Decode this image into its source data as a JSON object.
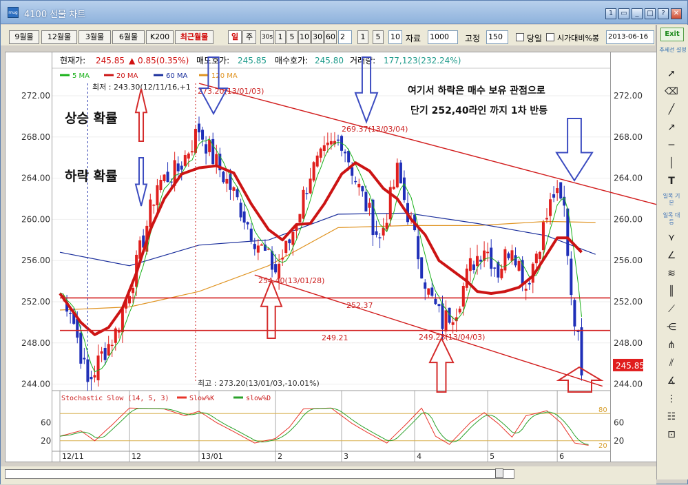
{
  "window": {
    "title": "4100 선물 차트",
    "controls": [
      "help-btn",
      "restore",
      "minimize",
      "maximize",
      "?",
      "X"
    ]
  },
  "toolbar": {
    "period_buttons": [
      "9월물",
      "12월물",
      "3월물",
      "6월물",
      "K200",
      "최근월물"
    ],
    "unit_buttons": [
      "일",
      "주"
    ],
    "interval_value": "30s",
    "minute_buttons": [
      "1",
      "5",
      "10",
      "30",
      "60"
    ],
    "interval_input": "2",
    "small_buttons": [
      "1",
      "5"
    ],
    "input_10": "10",
    "data_label": "자료",
    "data_count": "1000",
    "fixed_label": "고정",
    "fixed_value": "150",
    "today_label": "당일",
    "time_compare_label": "시가대비%봉",
    "date_value": "2013-06-16"
  },
  "sidebar": {
    "exit_label": "Exit",
    "setting_label": "추세선 설정",
    "tools": [
      "cursor-tool",
      "eraser-tool",
      "line-tool",
      "arrow-line-tool",
      "horizontal-line-tool",
      "vertical-line-tool",
      "text-tool"
    ],
    "text_tools": [
      "일목 기본",
      "일목 대등"
    ],
    "extra_tools": [
      "fan-tool",
      "fibonacci-tool",
      "speed-lines-tool",
      "cycle-tool",
      "gann-tool",
      "gann-fan-tool",
      "pitchfork-tool",
      "channel-tool",
      "angle-tool",
      "regression-tool",
      "retracement-tool"
    ]
  },
  "header": {
    "current_label": "현재가:",
    "current_value": "245.85",
    "change_value": "▲ 0.85(0.35%)",
    "ask_label": "매도호가:",
    "ask_value": "245.85",
    "bid_label": "매수호가:",
    "bid_value": "245.80",
    "volume_label": "거래량:",
    "volume_value": "177,123(232.24%)"
  },
  "annotations": {
    "up_prob": "상승 확률",
    "down_prob": "하락 확률",
    "note_line1": "여기서 하락은 매수 보유 관점으로",
    "note_line2": "단기 252,40라인 까지 1차 반등",
    "low_label": "최저 : 243.30(12/11/16,+1",
    "high_label": "최고 : 273.20(13/01/03,-10.01%)",
    "label_273": "273.20(13/01/03)",
    "label_269": "269.37(13/03/04)",
    "label_254": "254.40(13/01/28)",
    "label_249_28": "249.28(13/04/03)",
    "label_252_37": "252.37",
    "label_249_21": "249.21",
    "current_price_tag": "245.85"
  },
  "colors": {
    "up_candle": "#e0201e",
    "down_candle": "#1f2fb8",
    "ma5": "#19b119",
    "ma20": "#cc1414",
    "ma60": "#1b2f9c",
    "ma120": "#e09422",
    "trend": "#d21e1e",
    "stoch_k": "#e8342a",
    "stoch_d": "#2aa12a"
  },
  "chart_data": [
    {
      "type": "candlestick",
      "title": "4100 선물 차트",
      "legend": [
        "5 MA",
        "20 MA",
        "60 MA",
        "120 MA"
      ],
      "ylim": [
        242.5,
        274
      ],
      "y_ticks": [
        "244.00",
        "248.00",
        "252.00",
        "256.00",
        "260.00",
        "264.00",
        "268.00",
        "272.00"
      ],
      "x_tick_labels": [
        "12/11",
        "12",
        "13/01",
        "2",
        "3",
        "4",
        "5",
        "6"
      ],
      "x_tick_index": [
        0,
        20,
        40,
        62,
        81,
        102,
        123,
        143
      ],
      "n_days": 154,
      "key_points": [
        {
          "label": "low",
          "idx": 8,
          "value": 243.3
        },
        {
          "label": "high",
          "idx": 40,
          "value": 273.2
        },
        {
          "label": "swing_low",
          "idx": 62,
          "value": 254.4
        },
        {
          "label": "swing_high",
          "idx": 81,
          "value": 269.37
        },
        {
          "label": "swing_low2",
          "idx": 108,
          "value": 249.28
        },
        {
          "label": "recent_high",
          "idx": 142,
          "value": 264.0
        },
        {
          "label": "current",
          "idx": 150,
          "value": 245.85
        }
      ],
      "horizontal_lines": [
        252.37,
        249.21
      ],
      "trendline_upper": {
        "from": [
          40,
          273.2
        ],
        "to": [
          172,
          261.4
        ]
      },
      "trendline_lower": {
        "from": [
          56,
          254.6
        ],
        "to": [
          156,
          243.8
        ]
      },
      "ma20_path": [
        [
          0,
          252.8
        ],
        [
          6,
          250.0
        ],
        [
          10,
          248.8
        ],
        [
          14,
          249.5
        ],
        [
          18,
          251.4
        ],
        [
          22,
          254.8
        ],
        [
          26,
          259.0
        ],
        [
          30,
          262.0
        ],
        [
          35,
          264.4
        ],
        [
          40,
          265.0
        ],
        [
          45,
          265.2
        ],
        [
          50,
          264.5
        ],
        [
          55,
          261.5
        ],
        [
          60,
          259.0
        ],
        [
          64,
          258.0
        ],
        [
          68,
          259.5
        ],
        [
          72,
          259.6
        ],
        [
          76,
          261.5
        ],
        [
          81,
          264.4
        ],
        [
          85,
          265.5
        ],
        [
          89,
          264.7
        ],
        [
          93,
          263.0
        ],
        [
          97,
          262.0
        ],
        [
          101,
          260.0
        ],
        [
          105,
          258.5
        ],
        [
          109,
          256.0
        ],
        [
          113,
          255.0
        ],
        [
          117,
          254.0
        ],
        [
          120,
          253.0
        ],
        [
          124,
          252.8
        ],
        [
          128,
          253.0
        ],
        [
          132,
          253.4
        ],
        [
          136,
          254.5
        ],
        [
          140,
          256.6
        ],
        [
          143,
          258.2
        ],
        [
          146,
          258.2
        ],
        [
          150,
          256.8
        ]
      ],
      "ma60_path": [
        [
          0,
          256.8
        ],
        [
          20,
          255.5
        ],
        [
          40,
          257.5
        ],
        [
          60,
          258.0
        ],
        [
          80,
          260.5
        ],
        [
          100,
          260.6
        ],
        [
          120,
          259.6
        ],
        [
          140,
          258.4
        ],
        [
          154,
          256.6
        ]
      ],
      "ma120_path": [
        [
          0,
          251.2
        ],
        [
          20,
          251.5
        ],
        [
          40,
          253.0
        ],
        [
          60,
          255.5
        ],
        [
          80,
          259.2
        ],
        [
          100,
          259.4
        ],
        [
          120,
          259.4
        ],
        [
          140,
          259.8
        ],
        [
          154,
          259.7
        ]
      ]
    },
    {
      "type": "line",
      "title": "Stochastic Slow (14, 5, 3)",
      "series": [
        {
          "name": "Slow%K"
        },
        {
          "name": "slow%D"
        }
      ],
      "ylim": [
        0,
        100
      ],
      "y_ticks": [
        "20",
        "60",
        "80"
      ],
      "levels": [
        20,
        80
      ],
      "k_path": [
        [
          0,
          30
        ],
        [
          6,
          42
        ],
        [
          10,
          20
        ],
        [
          15,
          55
        ],
        [
          20,
          92
        ],
        [
          30,
          90
        ],
        [
          36,
          75
        ],
        [
          40,
          85
        ],
        [
          45,
          60
        ],
        [
          50,
          40
        ],
        [
          56,
          15
        ],
        [
          62,
          25
        ],
        [
          66,
          50
        ],
        [
          70,
          90
        ],
        [
          78,
          92
        ],
        [
          84,
          58
        ],
        [
          88,
          40
        ],
        [
          94,
          15
        ],
        [
          100,
          60
        ],
        [
          104,
          92
        ],
        [
          108,
          30
        ],
        [
          112,
          12
        ],
        [
          118,
          60
        ],
        [
          122,
          82
        ],
        [
          126,
          58
        ],
        [
          130,
          28
        ],
        [
          134,
          75
        ],
        [
          140,
          86
        ],
        [
          144,
          60
        ],
        [
          148,
          15
        ],
        [
          152,
          10
        ]
      ]
    }
  ]
}
